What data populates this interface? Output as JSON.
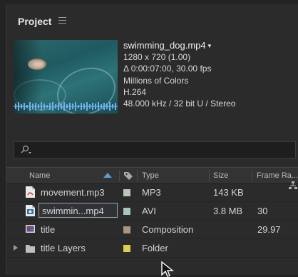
{
  "panel": {
    "title": "Project",
    "menu_icon": "hamburger-menu-icon"
  },
  "preview": {
    "filename": "swimming_dog.mp4",
    "dropdown_arrow": "▾",
    "lines": [
      "1280 x 720 (1.00)",
      "Δ 0:00:07:00, 30.00 fps",
      "Millions of Colors",
      "H.264",
      "48.000 kHz / 32 bit U / Stereo"
    ]
  },
  "search": {
    "icon": "magnifier-dropdown-icon",
    "placeholder": ""
  },
  "columns": {
    "name": "Name",
    "label_icon": "tag-icon",
    "type": "Type",
    "size": "Size",
    "frame_rate": "Frame Ra..."
  },
  "items": [
    {
      "name": "movement.mp3",
      "type": "MP3",
      "size": "143 KB",
      "frame_rate": "",
      "label_color": "#b8c9b4",
      "icon": "audio-file-icon",
      "selected": false,
      "folder": false
    },
    {
      "name": "swimmin...mp4",
      "type": "AVI",
      "size": "3.8 MB",
      "frame_rate": "30",
      "label_color": "#a8c4bd",
      "icon": "video-file-icon",
      "selected": true,
      "folder": false
    },
    {
      "name": "title",
      "type": "Composition",
      "size": "",
      "frame_rate": "29.97",
      "label_color": "#a99680",
      "icon": "composition-icon",
      "selected": false,
      "folder": false
    },
    {
      "name": "title Layers",
      "type": "Folder",
      "size": "",
      "frame_rate": "",
      "label_color": "#d9cf52",
      "icon": "folder-icon",
      "selected": false,
      "folder": true
    }
  ],
  "colors": {
    "panel_bg": "#2b2b2b",
    "accent_sort": "#5b9fd4"
  }
}
